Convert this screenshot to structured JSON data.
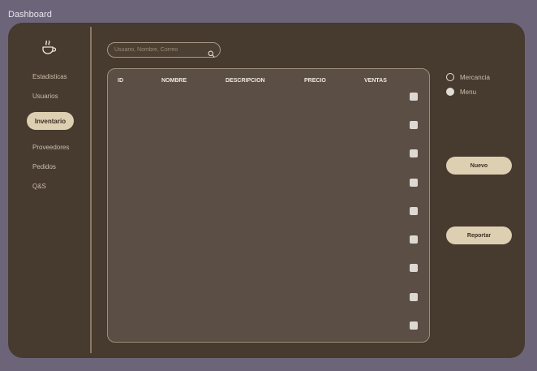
{
  "window": {
    "title": "Dashboard"
  },
  "sidebar": {
    "logo_icon": "steaming-cup-icon",
    "items": [
      {
        "label": "Estadisticas",
        "active": false
      },
      {
        "label": "Usuarios",
        "active": false
      },
      {
        "label": "Inventario",
        "active": true
      },
      {
        "label": "Proveedores",
        "active": false
      },
      {
        "label": "Pedidos",
        "active": false
      },
      {
        "label": "Q&S",
        "active": false
      }
    ]
  },
  "search": {
    "placeholder": "Usuario, Nombre, Correo",
    "value": "",
    "icon": "search-icon"
  },
  "table": {
    "columns": [
      "ID",
      "NOMBRE",
      "DESCRIPCION",
      "PRECIO",
      "VENTAS"
    ],
    "row_count": 9
  },
  "filters": {
    "options": [
      {
        "label": "Mercancia",
        "selected": false
      },
      {
        "label": "Menu",
        "selected": true
      }
    ]
  },
  "actions": {
    "new_label": "Nuevo",
    "report_label": "Reportar"
  },
  "colors": {
    "page_bg": "#6c6579",
    "panel_bg": "#473a2e",
    "table_bg": "#5b4e44",
    "accent": "#ddcfb2",
    "text": "#cbbfae"
  }
}
